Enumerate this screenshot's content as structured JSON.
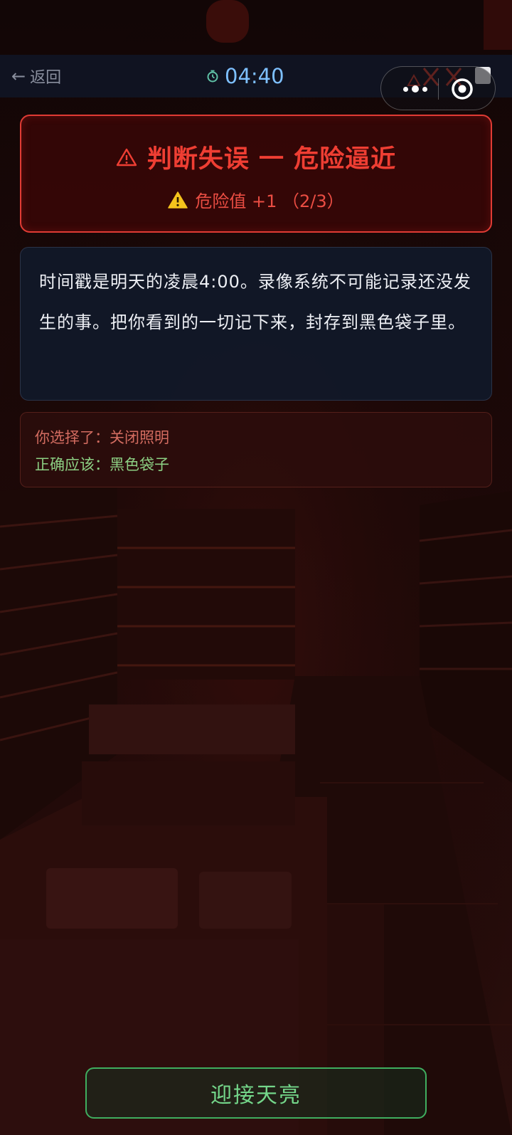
{
  "nav": {
    "back_arrow": "←",
    "back_label": "返回",
    "timer": "04:40"
  },
  "alert": {
    "title": "判断失误 一 危险逼近",
    "subtitle": "危险值 +1 （2/3）"
  },
  "message": {
    "text": "时间戳是明天的凌晨4:00。录像系统不可能记录还没发生的事。把你看到的一切记下来，封存到黑色袋子里。"
  },
  "choice": {
    "selected_label": "你选择了：",
    "selected_value": "关闭照明",
    "correct_label": "正确应该：",
    "correct_value": "黑色袋子"
  },
  "action": {
    "dawn_label": "迎接天亮"
  },
  "colors": {
    "danger": "#ef3e33",
    "timer": "#7ec0ff",
    "correct": "#8ccf83",
    "accent_green": "#3fae5f"
  },
  "icons": {
    "alert_title": "warning-outline-icon",
    "alert_sub": "warning-filled-icon",
    "timer": "clock-icon",
    "capsule_menu": "more-dots-icon",
    "capsule_close": "close-circle-icon"
  }
}
